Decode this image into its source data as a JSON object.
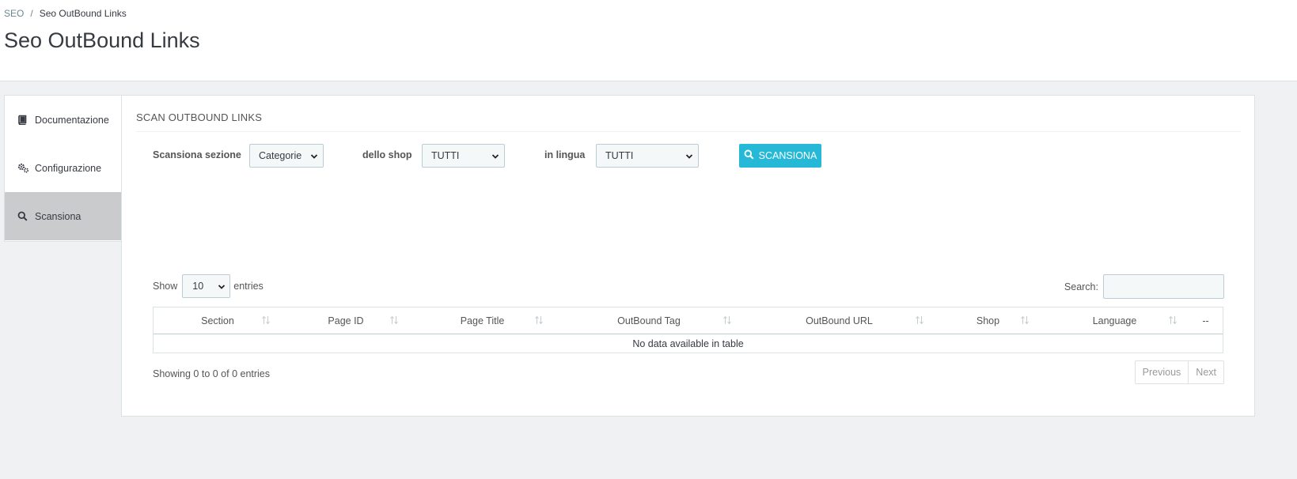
{
  "breadcrumb": {
    "root": "SEO",
    "separator": "/",
    "current": "Seo OutBound Links"
  },
  "page_title": "Seo OutBound Links",
  "sidebar": {
    "items": [
      {
        "label": "Documentazione",
        "icon": "book-icon",
        "active": false
      },
      {
        "label": "Configurazione",
        "icon": "cogs-icon",
        "active": false
      },
      {
        "label": "Scansiona",
        "icon": "search-icon",
        "active": true
      }
    ]
  },
  "panel": {
    "heading": "SCAN OUTBOUND LINKS",
    "form": {
      "section_label": "Scansiona sezione",
      "section_value": "Categorie",
      "shop_label": "dello shop",
      "shop_value": "TUTTI",
      "language_label": "in lingua",
      "language_value": "TUTTI",
      "scan_button": "SCANSIONA",
      "scan_button_icon": "search-icon"
    },
    "table": {
      "show_prefix": "Show",
      "length_value": "10",
      "show_suffix": "entries",
      "search_label": "Search:",
      "columns": [
        "Section",
        "Page ID",
        "Page Title",
        "OutBound Tag",
        "OutBound URL",
        "Shop",
        "Language",
        "--"
      ],
      "empty_message": "No data available in table",
      "info": "Showing 0 to 0 of 0 entries",
      "prev_label": "Previous",
      "next_label": "Next"
    }
  },
  "colors": {
    "accent": "#25b9d7",
    "page_bg": "#eff1f2",
    "active_tab": "#c9cbcd"
  }
}
